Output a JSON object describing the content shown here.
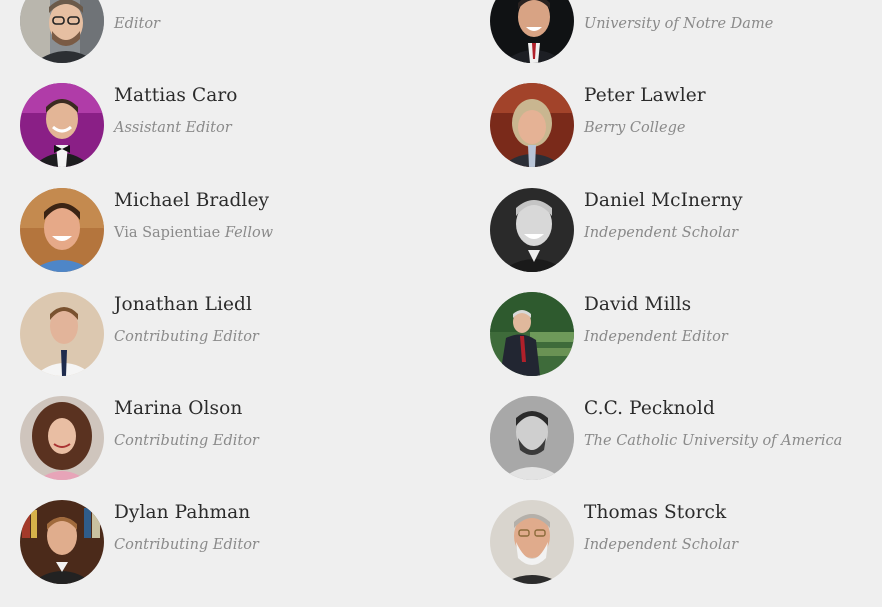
{
  "people": {
    "left": [
      {
        "name": "",
        "role_plain": "",
        "role_italic": "Editor",
        "photo": "glasses-man-photo"
      },
      {
        "name": "Mattias Caro",
        "role_plain": "",
        "role_italic": "Assistant Editor",
        "photo": "bowtie-man-photo"
      },
      {
        "name": "Michael Bradley",
        "role_plain": "Via Sapientiae",
        "role_italic": "Fellow",
        "photo": "smiling-man-photo"
      },
      {
        "name": "Jonathan Liedl",
        "role_plain": "",
        "role_italic": "Contributing Editor",
        "photo": "tie-man-photo"
      },
      {
        "name": "Marina Olson",
        "role_plain": "",
        "role_italic": "Contributing Editor",
        "photo": "curly-hair-woman-photo"
      },
      {
        "name": "Dylan Pahman",
        "role_plain": "",
        "role_italic": "Contributing Editor",
        "photo": "bookshelf-man-photo"
      }
    ],
    "right": [
      {
        "name": "",
        "role_plain": "",
        "role_italic": "University of Notre Dame",
        "photo": "suit-man-photo"
      },
      {
        "name": "Peter Lawler",
        "role_plain": "",
        "role_italic": "Berry College",
        "photo": "gray-hair-man-photo"
      },
      {
        "name": "Daniel McInerny",
        "role_plain": "",
        "role_italic": "Independent Scholar",
        "photo": "bw-smiling-man-photo"
      },
      {
        "name": "David Mills",
        "role_plain": "",
        "role_italic": "Independent Editor",
        "photo": "garden-man-photo"
      },
      {
        "name": "C.C. Pecknold",
        "role_plain": "",
        "role_italic": "The Catholic University of America",
        "photo": "bw-bearded-man-photo"
      },
      {
        "name": "Thomas Storck",
        "role_plain": "",
        "role_italic": "Independent Scholar",
        "photo": "white-beard-man-photo"
      }
    ]
  }
}
